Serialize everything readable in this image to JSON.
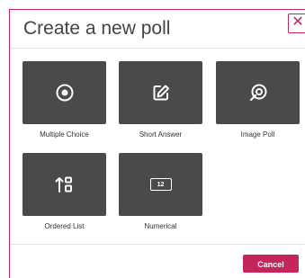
{
  "dialog": {
    "title": "Create a new poll",
    "close_symbol": "✕"
  },
  "poll_types": [
    {
      "label": "Multiple Choice",
      "icon": "radio-button-icon"
    },
    {
      "label": "Short Answer",
      "icon": "edit-icon"
    },
    {
      "label": "Image Poll",
      "icon": "image-poll-icon"
    },
    {
      "label": "Ordered List",
      "icon": "ordered-list-icon"
    },
    {
      "label": "Numerical",
      "icon": "numerical-icon"
    }
  ],
  "icons": {
    "numerical_text": "12"
  },
  "footer": {
    "cancel_label": "Cancel"
  },
  "colors": {
    "accent": "#c6245d",
    "tile": "#4a4a4a"
  }
}
